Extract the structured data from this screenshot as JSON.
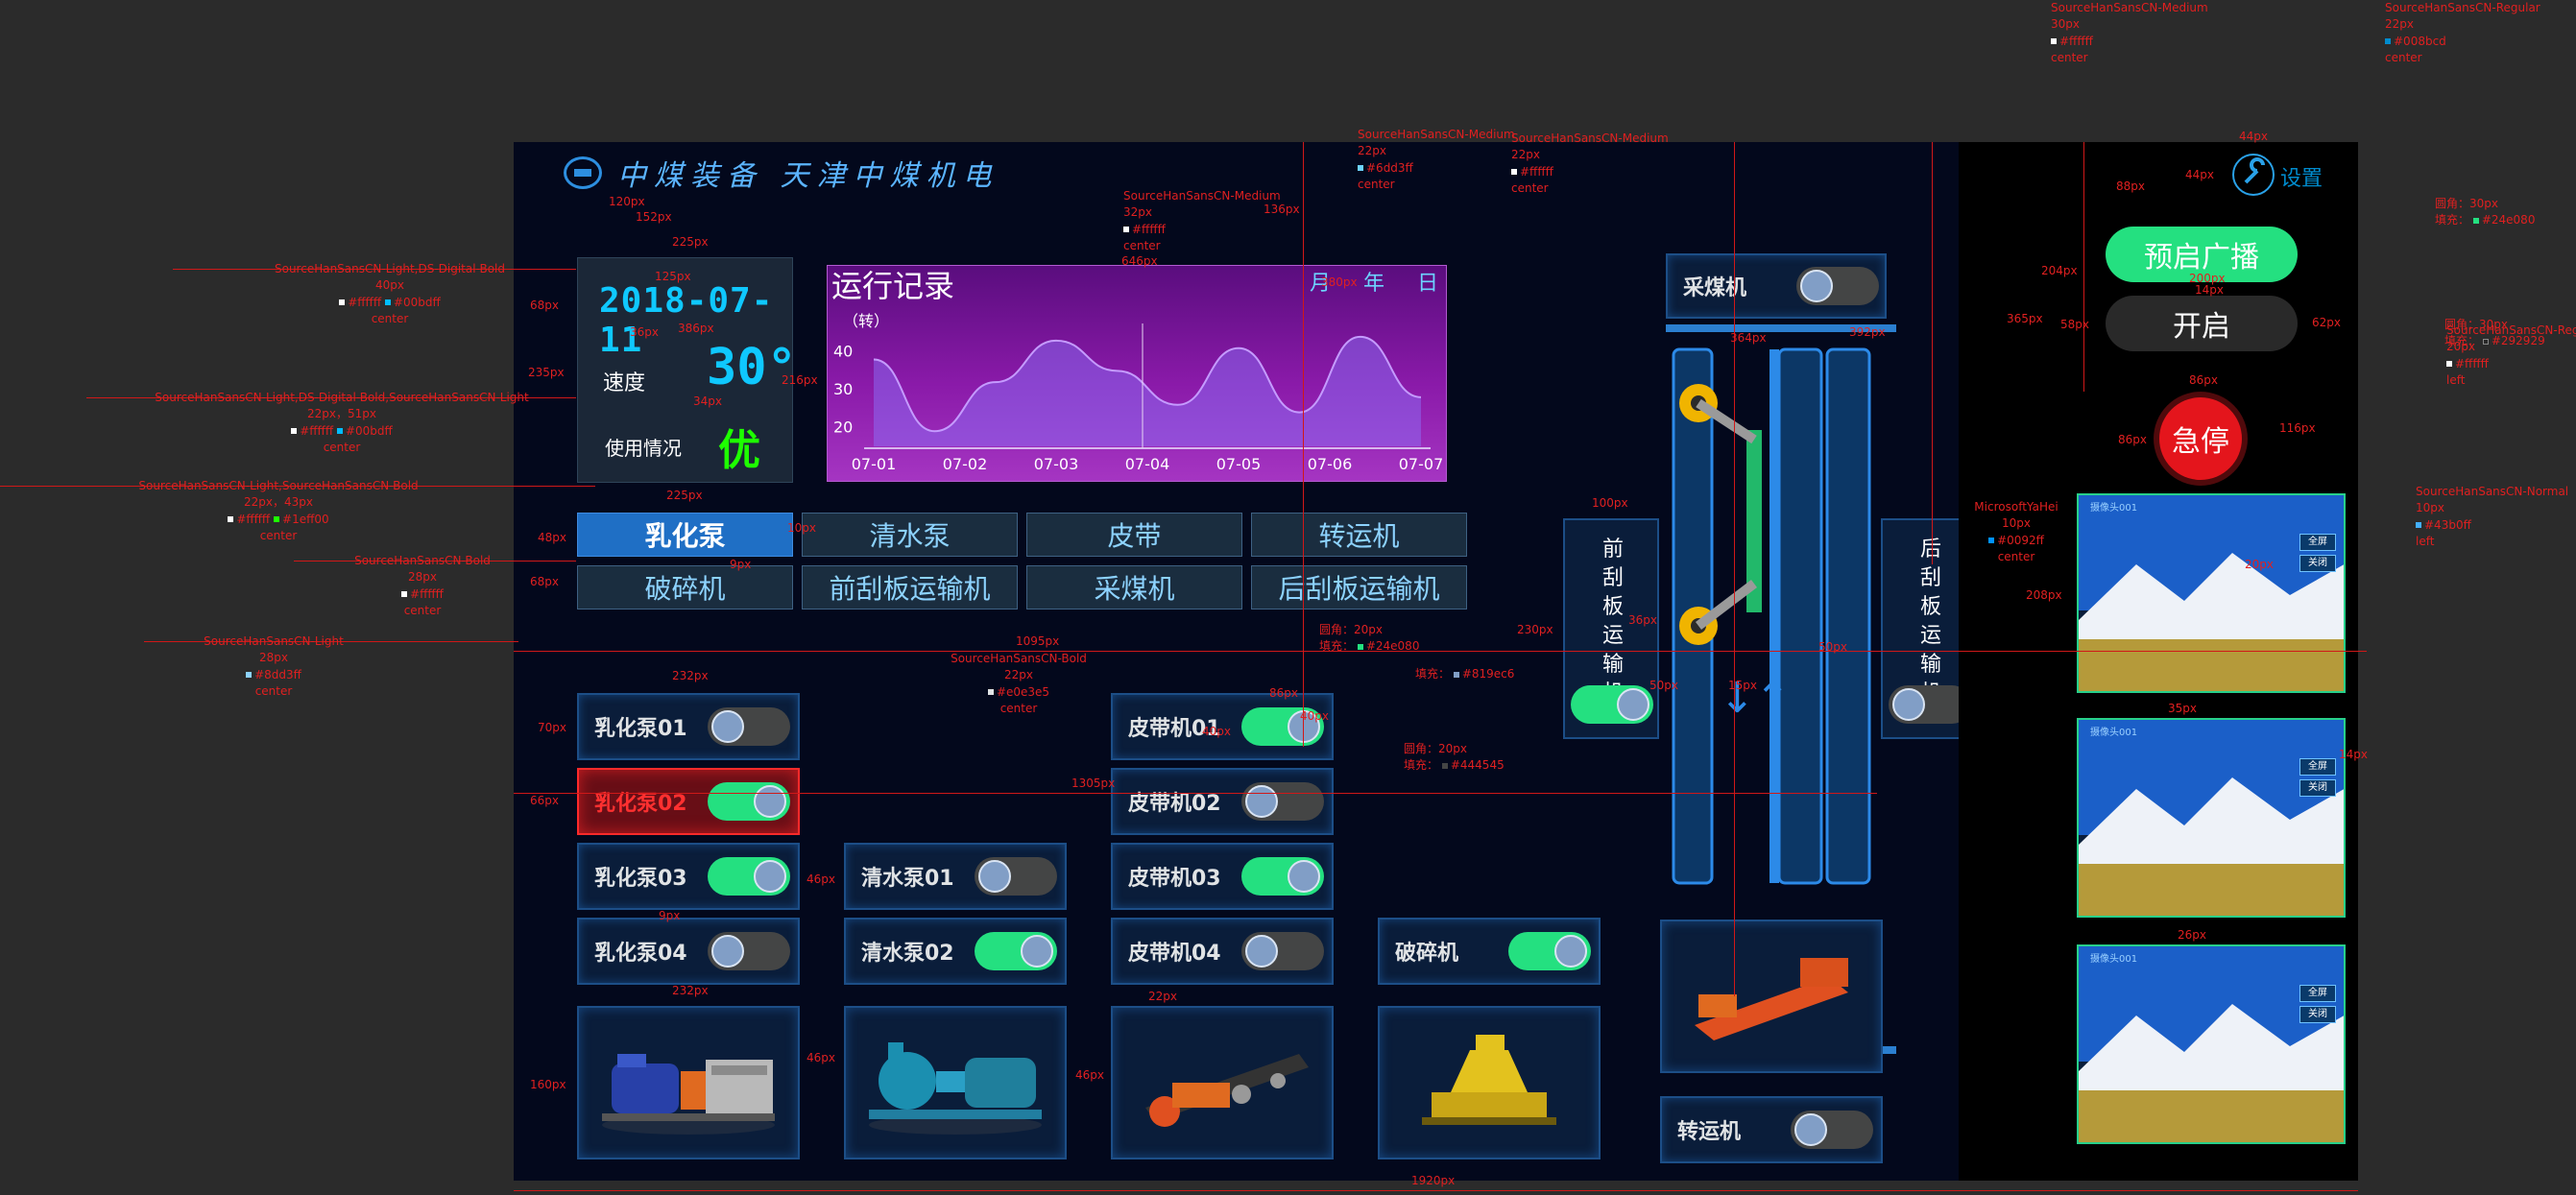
{
  "app": {
    "brand": "中煤装备 天津中煤机电"
  },
  "status": {
    "date": "2018-07-11",
    "speed_label": "速度",
    "speed_value": "30°",
    "usage_label": "使用情况",
    "usage_value": "优"
  },
  "chart": {
    "title": "运行记录",
    "unit": "（转）",
    "periods": [
      "月",
      "年",
      "日"
    ]
  },
  "chart_data": {
    "type": "area",
    "title": "运行记录",
    "ylabel": "（转）",
    "x": [
      "07-01",
      "07-02",
      "07-03",
      "07-04",
      "07-05",
      "07-06",
      "07-07"
    ],
    "y_ticks": [
      "40",
      "30",
      "20"
    ],
    "ylim": [
      15,
      45
    ],
    "series": [
      {
        "values": [
          38,
          19,
          32,
          43,
          35,
          26,
          41,
          24,
          44,
          28
        ]
      }
    ],
    "grid": false,
    "accent": "#c59bff"
  },
  "tabs": {
    "row1": [
      "乳化泵",
      "清水泵",
      "皮带",
      "转运机"
    ],
    "row2": [
      "破碎机",
      "前刮板运输机",
      "采煤机",
      "后刮板运输机"
    ]
  },
  "devices": {
    "col1": [
      {
        "name": "乳化泵01",
        "on": false,
        "alert": false
      },
      {
        "name": "乳化泵02",
        "on": true,
        "alert": true
      },
      {
        "name": "乳化泵03",
        "on": true,
        "alert": false
      },
      {
        "name": "乳化泵04",
        "on": false,
        "alert": false
      }
    ],
    "col2": [
      {
        "name": "清水泵01",
        "on": false,
        "alert": false
      },
      {
        "name": "清水泵02",
        "on": true,
        "alert": false
      }
    ],
    "col3": [
      {
        "name": "皮带机01",
        "on": true,
        "alert": false
      },
      {
        "name": "皮带机02",
        "on": false,
        "alert": false
      },
      {
        "name": "皮带机03",
        "on": true,
        "alert": false
      },
      {
        "name": "皮带机04",
        "on": false,
        "alert": false
      }
    ],
    "crusher": {
      "name": "破碎机",
      "on": true
    },
    "shearer": {
      "name": "采煤机",
      "on": false
    },
    "transfer": {
      "name": "转运机",
      "on": false
    }
  },
  "conveyors": {
    "front": {
      "label": "前刮板运输机",
      "on": true
    },
    "rear": {
      "label": "后刮板运输机",
      "on": false
    }
  },
  "controls": {
    "settings_label": "设置",
    "broadcast_label": "预启广播",
    "start_label": "开启",
    "estop_label": "急停"
  },
  "cameras": [
    {
      "title": "摄像头001",
      "fullscreen": "全屏",
      "close": "关闭"
    },
    {
      "title": "摄像头001",
      "fullscreen": "全屏",
      "close": "关闭"
    },
    {
      "title": "摄像头001",
      "fullscreen": "全屏",
      "close": "关闭"
    }
  ],
  "annotations": {
    "a01": "SourceHanSansCN-Medium",
    "a02": "30px",
    "a03": "#ffffff",
    "a04": "center",
    "a05": "SourceHanSansCN-Regular",
    "a06": "22px",
    "a07": "#008bcd",
    "a08": "center",
    "a09": "SourceHanSansCN-Medium",
    "a10": "22px",
    "a11": "#6dd3ff",
    "a12": "center",
    "a13": "SourceHanSansCN-Medium",
    "a14": "22px",
    "a15": "#ffffff",
    "a16": "center",
    "a17": "SourceHanSansCN-Medium",
    "a18": "32px",
    "a19": "#ffffff",
    "a20": "center",
    "a21": "SourceHanSansCN-Light,DS-Digital-Bold",
    "a22": "40px",
    "a23": "#ffffff",
    "a24": "#00bdff",
    "a25": "center",
    "a26": "SourceHanSansCN-Light,DS-Digital-Bold,SourceHanSansCN-Light",
    "a27": "22px，51px",
    "a28": "#ffffff",
    "a29": "#00bdff",
    "a30": "center",
    "a31": "SourceHanSansCN-Light,SourceHanSansCN-Bold",
    "a32": "22px，43px",
    "a33": "#ffffff",
    "a34": "#1eff00",
    "a35": "center",
    "a36": "SourceHanSansCN-Bold",
    "a37": "28px",
    "a38": "#ffffff",
    "a39": "center",
    "a40": "SourceHanSansCN-Light",
    "a41": "28px",
    "a42": "#8dd3ff",
    "a43": "center",
    "a44": "SourceHanSansCN-Bold",
    "a45": "22px",
    "a46": "#e0e3e5",
    "a47": "center",
    "a48": "SourceHanSansCN-Regular",
    "a49": "20px",
    "a50": "#ffffff",
    "a51": "left",
    "a52": "MicrosoftYaHei",
    "a53": "10px",
    "a54": "#0092ff",
    "a55": "center",
    "a56": "SourceHanSansCN-Normal",
    "a57": "10px",
    "a58": "#43b0ff",
    "a59": "left",
    "a60": "圆角：20px",
    "a61": "填充：",
    "a62": "#24e080",
    "a63": "填充：",
    "a64": "#819ec6",
    "a65": "圆角：20px",
    "a66": "填充：",
    "a67": "#444545",
    "a68": "圆角：30px",
    "a69": "填充：",
    "a70": "#24e080",
    "a71": "圆角：30px",
    "a72": "填充：",
    "a73": "#292929",
    "d01": "120px",
    "d02": "152px",
    "d03": "125px",
    "d04": "225px",
    "d05": "68px",
    "d06": "36px",
    "d07": "386px",
    "d08": "235px",
    "d09": "216px",
    "d10": "34px",
    "d11": "225px",
    "d12": "48px",
    "d13": "10px",
    "d14": "9px",
    "d15": "68px",
    "d16": "1095px",
    "d17": "232px",
    "d18": "70px",
    "d19": "66px",
    "d20": "46px",
    "d21": "9px",
    "d22": "232px",
    "d23": "160px",
    "d24": "46px",
    "d25": "46px",
    "d26": "22px",
    "d27": "1305px",
    "d28": "86px",
    "d29": "40px",
    "d30": "40px",
    "d31": "1920px",
    "d32": "136px",
    "d33": "646px",
    "d34": "380px",
    "d35": "100px",
    "d36": "230px",
    "d37": "50px",
    "d38": "36px",
    "d39": "15px",
    "d40": "50px",
    "d41": "392px",
    "d42": "364px",
    "d43": "204px",
    "d44": "365px",
    "d45": "58px",
    "d46": "88px",
    "d47": "44px",
    "d48": "44px",
    "d49": "200px",
    "d50": "14px",
    "d51": "62px",
    "d52": "86px",
    "d53": "86px",
    "d54": "116px",
    "d55": "208px",
    "d56": "20px",
    "d57": "35px",
    "d58": "26px",
    "d59": "14px"
  }
}
